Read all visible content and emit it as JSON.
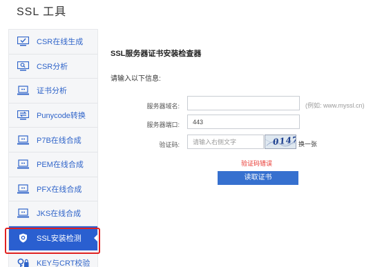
{
  "page": {
    "title": "SSL 工具"
  },
  "sidebar": {
    "items": [
      {
        "label": "CSR在线生成",
        "icon": "monitor-check-icon",
        "active": false
      },
      {
        "label": "CSR分析",
        "icon": "monitor-search-icon",
        "active": false
      },
      {
        "label": "证书分析",
        "icon": "laptop-link-icon",
        "active": false
      },
      {
        "label": "Punycode转换",
        "icon": "monitor-switch-icon",
        "active": false
      },
      {
        "label": "P7B在线合成",
        "icon": "laptop-link-icon",
        "active": false
      },
      {
        "label": "PEM在线合成",
        "icon": "laptop-link-icon",
        "active": false
      },
      {
        "label": "PFX在线合成",
        "icon": "laptop-link-icon",
        "active": false
      },
      {
        "label": "JKS在线合成",
        "icon": "laptop-link-icon",
        "active": false
      },
      {
        "label": "SSL安装检测",
        "icon": "shield-check-icon",
        "active": true
      },
      {
        "label": "KEY与CRT校验",
        "icon": "key-lock-icon",
        "active": false
      }
    ]
  },
  "main": {
    "section_title": "SSL服务器证书安装检查器",
    "prompt": "请输入以下信息:"
  },
  "form": {
    "domain_label": "服务器域名:",
    "domain_value": "",
    "domain_hint": "(例如:  www.myssl.cn)",
    "port_label": "服务器端口:",
    "port_value": "443",
    "captcha_label": "验证码:",
    "captcha_placeholder": "请输入右侧文字",
    "captcha_image_text": "0147",
    "refresh_label": "换一张",
    "error_text": "验证码错误",
    "submit_label": "读取证书"
  },
  "colors": {
    "accent": "#2a5fd0",
    "link": "#2e63c9",
    "error": "#e8362f",
    "highlight": "#e02020"
  }
}
